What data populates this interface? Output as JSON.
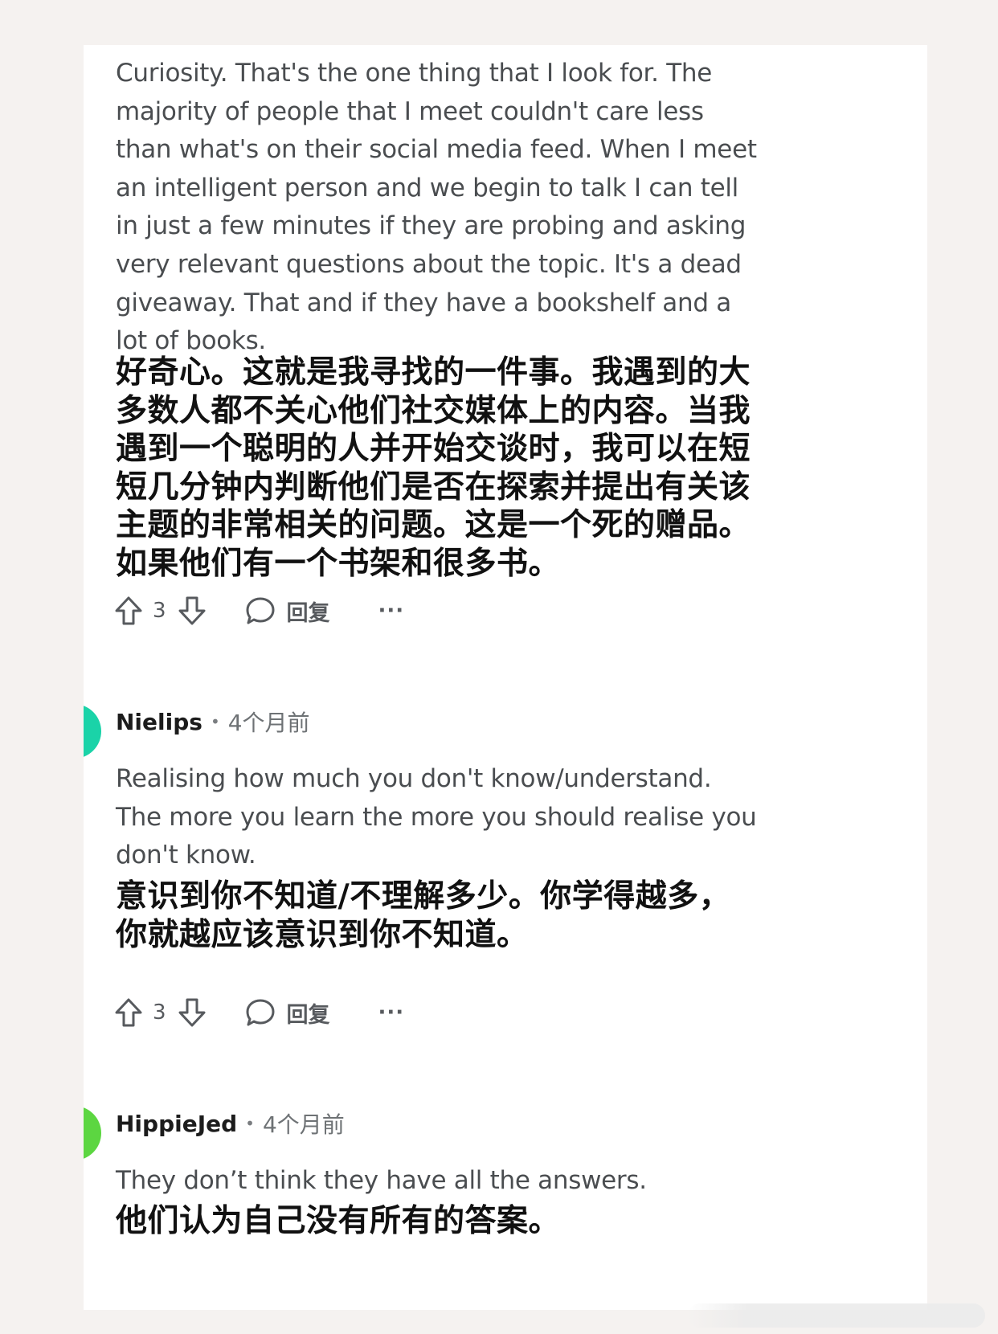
{
  "comments": [
    {
      "body_en": "Curiosity. That's the one thing that I look for. The majority of people that I meet couldn't care less than what's on their social media feed. When I meet an intelligent person and we begin to talk I can tell in just a few minutes if they are probing and asking very relevant questions about the topic. It's a dead giveaway. That and if they have a bookshelf and a lot of books.",
      "body_zh": "好奇心。这就是我寻找的一件事。我遇到的大多数人都不关心他们社交媒体上的内容。当我遇到一个聪明的人并开始交谈时，我可以在短短几分钟内判断他们是否在探索并提出有关该主题的非常相关的问题。这是一个死的赠品。如果他们有一个书架和很多书。",
      "votes": "3",
      "reply_label": "回复",
      "more_label": "···"
    },
    {
      "author": "Nielips",
      "time": "4个月前",
      "avatar_color": "#1ad3a8",
      "body_en": "Realising how much you don't know/understand. The more you learn the more you should realise you don't know.",
      "body_zh": "意识到你不知道/不理解多少。你学得越多，你就越应该意识到你不知道。",
      "votes": "3",
      "reply_label": "回复",
      "more_label": "···"
    },
    {
      "author": "HippieJed",
      "time": "4个月前",
      "avatar_color": "#5cd641",
      "body_en": "They don’t think they have all the answers.",
      "body_zh": "他们认为自己没有所有的答案。"
    }
  ],
  "meta_separator": "•",
  "icons": [
    "upvote-icon",
    "downvote-icon",
    "reply-bubble-icon"
  ],
  "colors": {
    "text_en": "#4a4d50",
    "text_zh": "#111111",
    "page_bg": "#f5f2f0",
    "card_bg": "#ffffff"
  }
}
